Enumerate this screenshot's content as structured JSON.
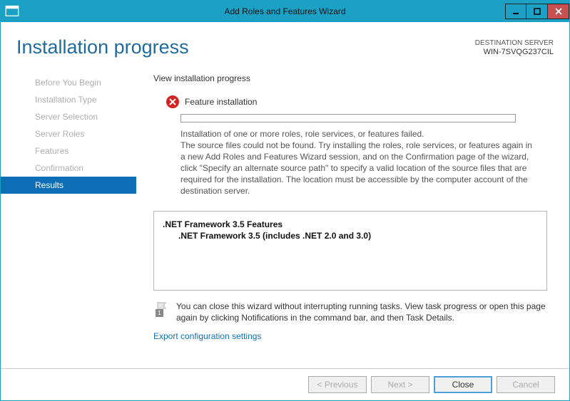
{
  "titlebar": {
    "title": "Add Roles and Features Wizard"
  },
  "header": {
    "page_title": "Installation progress",
    "dest_label": "DESTINATION SERVER",
    "dest_server": "WIN-7SVQG237CIL"
  },
  "sidebar": {
    "items": [
      {
        "label": "Before You Begin"
      },
      {
        "label": "Installation Type"
      },
      {
        "label": "Server Selection"
      },
      {
        "label": "Server Roles"
      },
      {
        "label": "Features"
      },
      {
        "label": "Confirmation"
      },
      {
        "label": "Results"
      }
    ]
  },
  "content": {
    "section_heading": "View installation progress",
    "status_title": "Feature installation",
    "error_line1": "Installation of one or more roles, role services, or features failed.",
    "error_body": "The source files could not be found. Try installing the roles, role services, or features again in a new Add Roles and Features Wizard session, and on the Confirmation page of the wizard, click \"Specify an alternate source path\" to specify a valid location of the source files that are required for the installation. The location must be accessible by the computer account of the destination server.",
    "feature_group": ".NET Framework 3.5 Features",
    "feature_child": ".NET Framework 3.5 (includes .NET 2.0 and 3.0)",
    "note_text": "You can close this wizard without interrupting running tasks. View task progress or open this page again by clicking Notifications in the command bar, and then Task Details.",
    "flag_badge": "1",
    "export_link": "Export configuration settings"
  },
  "footer": {
    "previous": "< Previous",
    "next": "Next >",
    "close": "Close",
    "cancel": "Cancel"
  }
}
